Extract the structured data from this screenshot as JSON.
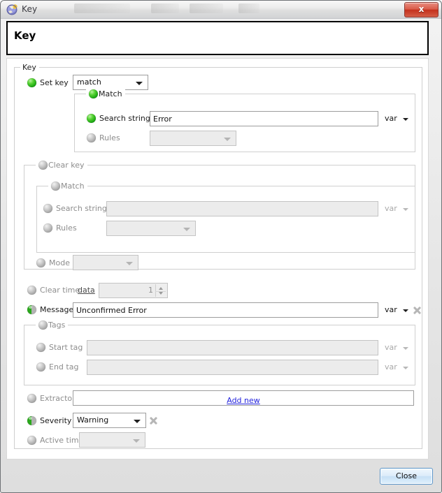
{
  "window": {
    "title": "Key",
    "app_icon": "globe-icon",
    "close_label": "x"
  },
  "header": {
    "title": "Key"
  },
  "groups": {
    "key": {
      "title": "Key"
    },
    "set_match": {
      "title": "Match"
    },
    "clear_key": {
      "title": "Clear key"
    },
    "clear_match": {
      "title": "Match"
    },
    "tags": {
      "title": "Tags"
    }
  },
  "rows": {
    "set_key": {
      "label": "Set key",
      "led": "on",
      "value": "match"
    },
    "set_search_string": {
      "label": "Search string",
      "led": "on",
      "value": "Error",
      "var_label": "var"
    },
    "set_rules": {
      "label": "Rules",
      "led": "off",
      "value": ""
    },
    "clear_search_string": {
      "label": "Search string",
      "led": "off",
      "value": "",
      "var_label": "var"
    },
    "clear_rules": {
      "label": "Rules",
      "led": "off",
      "value": ""
    },
    "mode": {
      "label": "Mode",
      "led": "off",
      "value": ""
    },
    "clear_time": {
      "label": "Clear time",
      "led": "off",
      "link": "data",
      "value": "1"
    },
    "message": {
      "label": "Message",
      "led": "half",
      "value": "Unconfirmed Error",
      "var_label": "var"
    },
    "start_tag": {
      "label": "Start tag",
      "led": "off",
      "value": "",
      "var_label": "var"
    },
    "end_tag": {
      "label": "End tag",
      "led": "off",
      "value": "",
      "var_label": "var"
    },
    "extractors": {
      "label": "Extractors",
      "led": "off",
      "add_new": "Add new"
    },
    "severity": {
      "label": "Severity",
      "led": "half",
      "value": "Warning"
    },
    "active_time": {
      "label": "Active time",
      "led": "off",
      "value": ""
    }
  },
  "footer": {
    "close_label": "Close"
  },
  "colors": {
    "led_on": "#2aa81c",
    "led_off": "#b3b3b3",
    "link_blue": "#2424dd",
    "close_red": "#c4311d",
    "accent_blue": "#5b95c9"
  }
}
